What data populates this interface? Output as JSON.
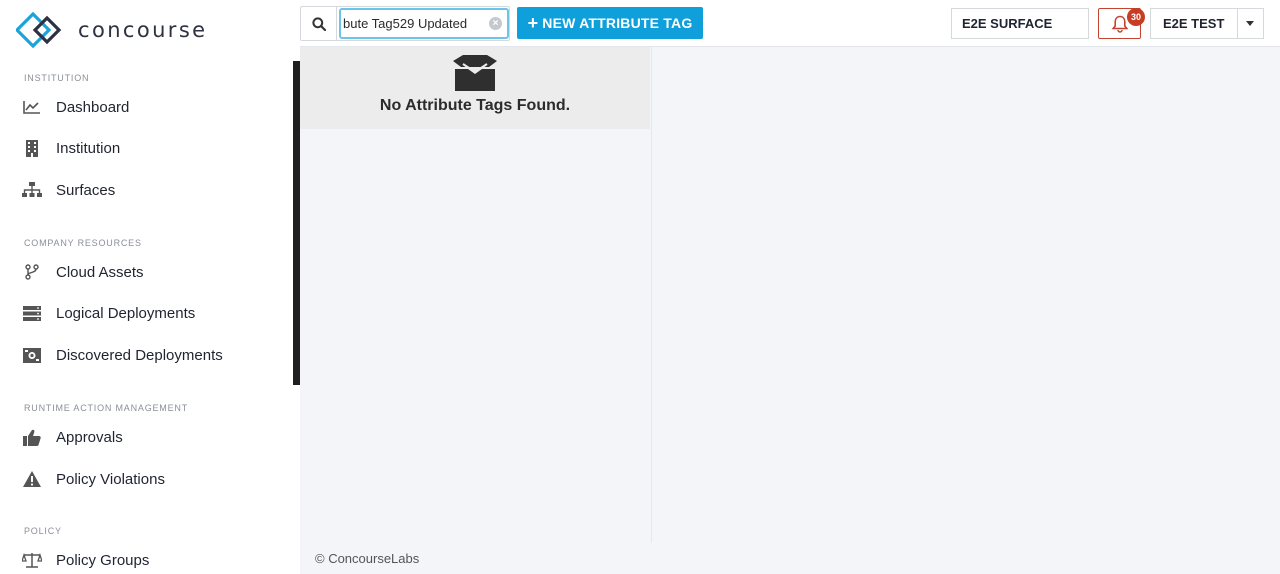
{
  "app": {
    "brand_name": "concourse",
    "accent_color": "#0f9fdb"
  },
  "sidebar": {
    "sections": [
      {
        "title": "INSTITUTION",
        "items": [
          {
            "label": "Dashboard",
            "icon": "chart-line-icon"
          },
          {
            "label": "Institution",
            "icon": "building-icon"
          },
          {
            "label": "Surfaces",
            "icon": "sitemap-icon"
          }
        ]
      },
      {
        "title": "COMPANY RESOURCES",
        "items": [
          {
            "label": "Cloud Assets",
            "icon": "code-branch-icon"
          },
          {
            "label": "Logical Deployments",
            "icon": "server-icon"
          },
          {
            "label": "Discovered Deployments",
            "icon": "discovered-icon"
          }
        ]
      },
      {
        "title": "RUNTIME ACTION MANAGEMENT",
        "items": [
          {
            "label": "Approvals",
            "icon": "thumbs-up-icon"
          },
          {
            "label": "Policy Violations",
            "icon": "warning-icon"
          }
        ]
      },
      {
        "title": "POLICY",
        "items": [
          {
            "label": "Policy Groups",
            "icon": "balance-scale-icon"
          }
        ]
      }
    ]
  },
  "header": {
    "search": {
      "value": "bute Tag529 Updated",
      "placeholder": ""
    },
    "new_button_label": "NEW ATTRIBUTE TAG",
    "surface_label": "E2E SURFACE",
    "notification_count": "30",
    "user_label": "E2E TEST"
  },
  "main": {
    "empty_message": "No Attribute Tags Found."
  },
  "footer": {
    "text": "© ConcourseLabs"
  }
}
